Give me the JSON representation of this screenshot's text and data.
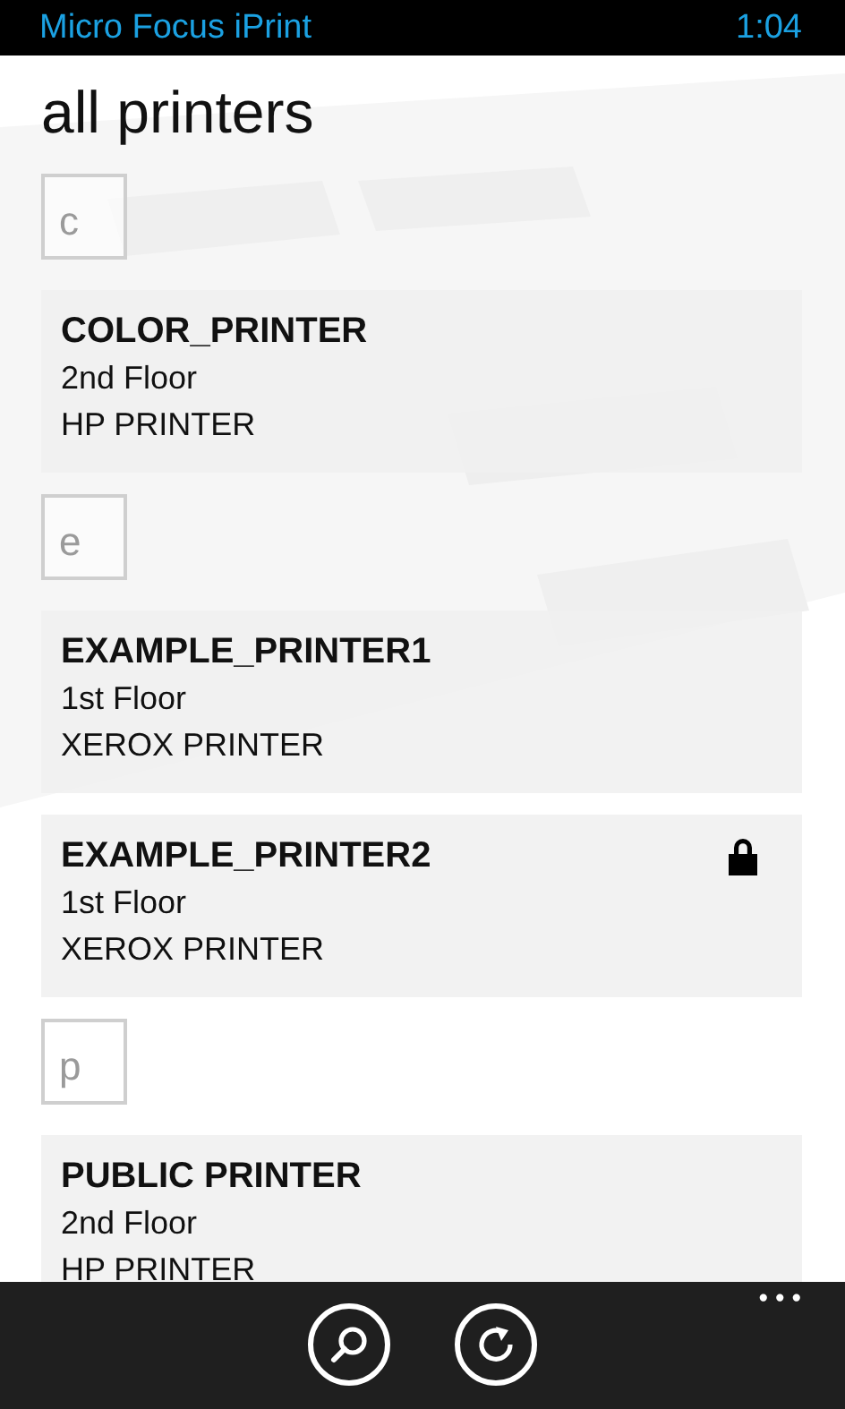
{
  "status_bar": {
    "app_name": "Micro Focus iPrint",
    "time": "1:04"
  },
  "page_title": "all printers",
  "groups": [
    {
      "letter": "c",
      "printers": [
        {
          "name": "COLOR_PRINTER",
          "location": "2nd Floor",
          "model": "HP PRINTER",
          "locked": false
        }
      ]
    },
    {
      "letter": "e",
      "printers": [
        {
          "name": "EXAMPLE_PRINTER1",
          "location": "1st Floor",
          "model": "XEROX PRINTER",
          "locked": false
        },
        {
          "name": "EXAMPLE_PRINTER2",
          "location": "1st Floor",
          "model": "XEROX PRINTER",
          "locked": true
        }
      ]
    },
    {
      "letter": "p",
      "printers": [
        {
          "name": "PUBLIC PRINTER",
          "location": "2nd Floor",
          "model": "HP PRINTER",
          "locked": false
        }
      ]
    }
  ],
  "app_bar": {
    "buttons": [
      {
        "kind": "search"
      },
      {
        "kind": "refresh"
      }
    ],
    "more": "•••"
  }
}
